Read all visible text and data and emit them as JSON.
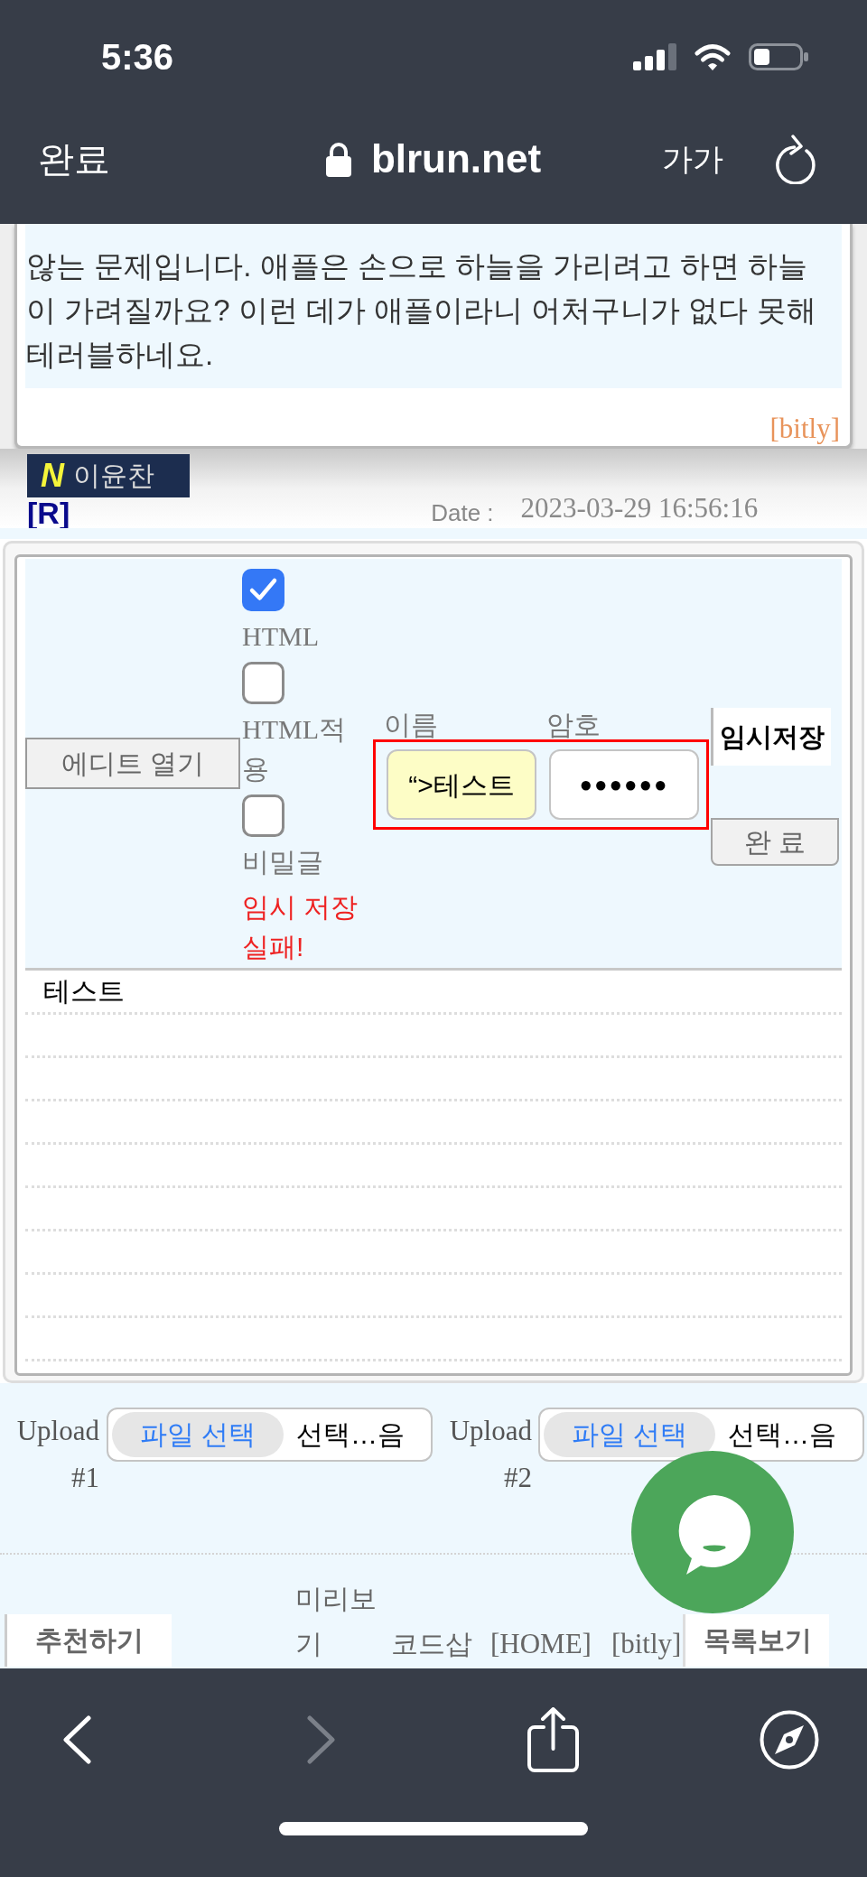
{
  "status_bar": {
    "time": "5:36"
  },
  "browser_bar": {
    "done_button": "완료",
    "address": "blrun.net",
    "text_size_button": "가가"
  },
  "comment": {
    "body": "않는 문제입니다. 애플은 손으로 하늘을 가리려고 하면 하늘이 가려질까요? 이런 데가 애플이라니 어처구니가 없다 못해 테러블하네요.",
    "link": "[bitly]"
  },
  "author": {
    "new_mark": "N",
    "name": "이윤찬",
    "reply_link": "[R]",
    "date_label": "Date :",
    "date": "2023-03-29 16:56:16"
  },
  "form": {
    "editor_button": "에디트 열기",
    "options": [
      {
        "label": "HTML",
        "checked": true
      },
      {
        "label": "HTML적용",
        "checked": false
      },
      {
        "label": "비밀글",
        "checked": false
      }
    ],
    "error_message": "임시 저장 실패!",
    "fields": [
      {
        "kind": "name",
        "label": "이름",
        "value": "“>테스트"
      },
      {
        "kind": "password",
        "label": "암호",
        "value": "●●●●●●"
      }
    ],
    "save_draft_button": "임시저장",
    "submit_button": "완 료",
    "content": "테스트"
  },
  "uploads": [
    {
      "label": "Upload #1",
      "button": "파일 선택",
      "status": "선택…음"
    },
    {
      "label": "Upload #2",
      "button": "파일 선택",
      "status": "선택…음"
    }
  ],
  "footer": {
    "recommend_button": "추천하기",
    "links": [
      "미리보기",
      "코드삽",
      "[HOME]",
      "[bitly]"
    ],
    "list_button": "목록보기"
  }
}
